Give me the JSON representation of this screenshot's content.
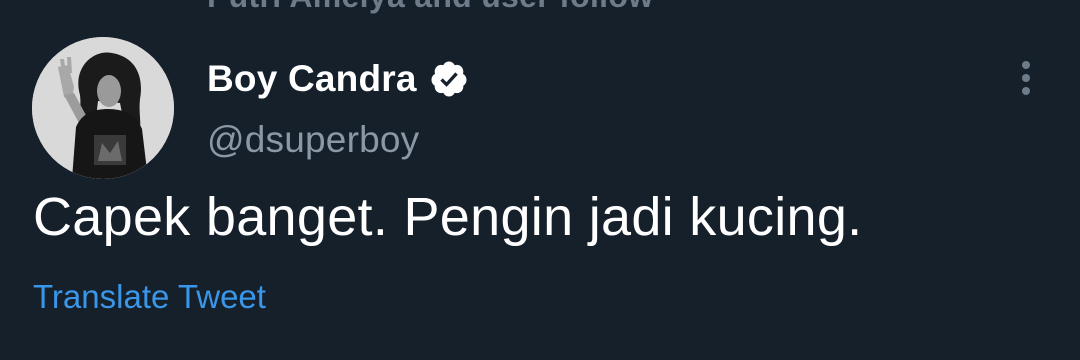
{
  "context": {
    "text": "Putri Amelya and user follow"
  },
  "tweet": {
    "author": {
      "display_name": "Boy Candra",
      "handle": "@dsuperboy",
      "verified_icon": "verified-badge-icon",
      "avatar_icon": "profile-photo"
    },
    "text": "Capek banget. Pengin jadi kucing.",
    "translate_label": "Translate Tweet",
    "more_icon": "vertical-ellipsis-icon"
  },
  "colors": {
    "background": "#16202b",
    "primary_text": "#ffffff",
    "secondary_text": "#8b98a5",
    "link": "#3996e8"
  }
}
